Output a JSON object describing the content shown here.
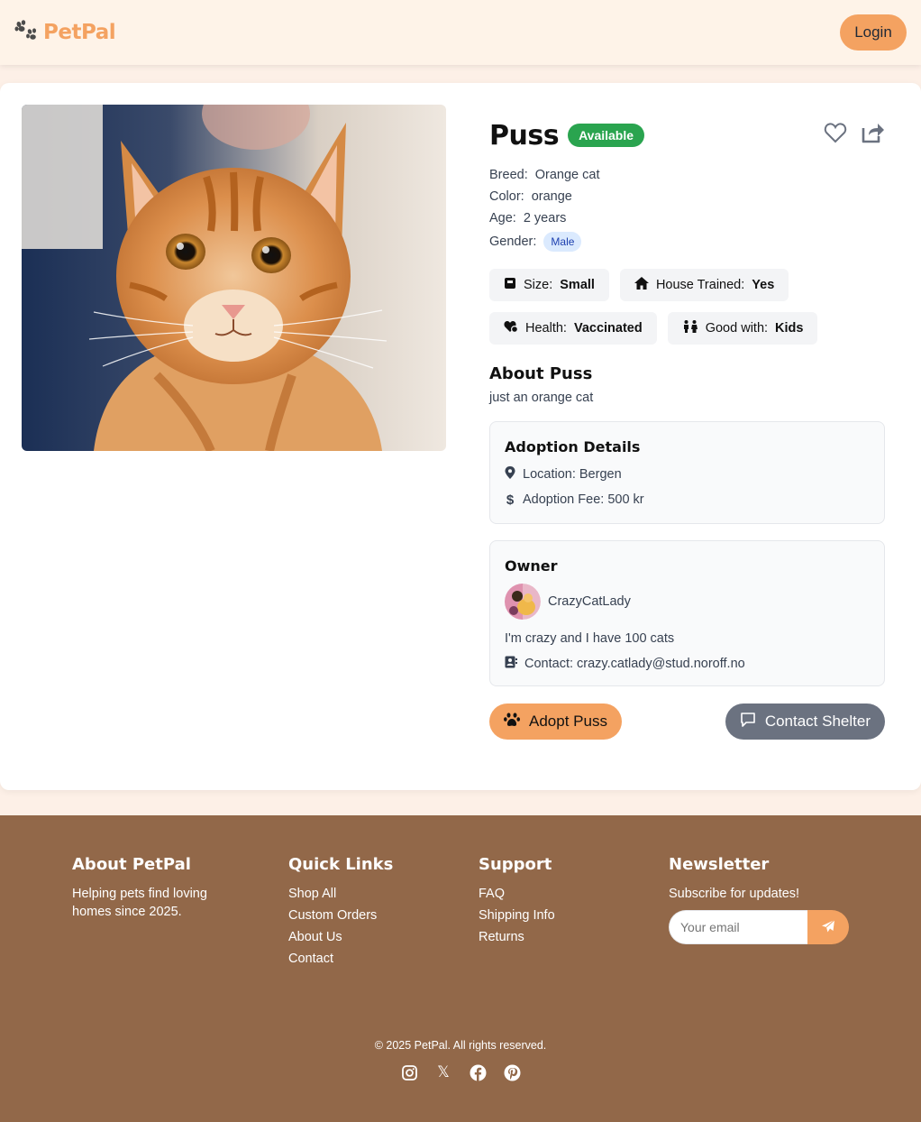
{
  "header": {
    "brand": "PetPal",
    "login_label": "Login"
  },
  "pet": {
    "name": "Puss",
    "status": "Available",
    "facts": [
      {
        "label": "Breed:",
        "value": "Orange cat"
      },
      {
        "label": "Color:",
        "value": "orange"
      },
      {
        "label": "Age:",
        "value": "2 years"
      },
      {
        "label": "Gender:",
        "value": "Male"
      }
    ],
    "chips": [
      {
        "label": "Size:",
        "value": "Small",
        "icon": "ruler-box-icon"
      },
      {
        "label": "House Trained:",
        "value": "Yes",
        "icon": "house-icon"
      },
      {
        "label": "Health:",
        "value": "Vaccinated",
        "icon": "heart-shield-icon"
      },
      {
        "label": "Good with:",
        "value": "Kids",
        "icon": "children-icon"
      }
    ],
    "about_title": "About Puss",
    "about_text": "just an orange cat"
  },
  "adoption": {
    "title": "Adoption Details",
    "location": "Location: Bergen",
    "fee": "Adoption Fee: 500 kr"
  },
  "owner": {
    "title": "Owner",
    "name": "CrazyCatLady",
    "bio": "I'm crazy and I have 100 cats",
    "contact": "Contact: crazy.catlady@stud.noroff.no"
  },
  "actions": {
    "adopt_label": "Adopt Puss",
    "contact_label": "Contact Shelter"
  },
  "footer": {
    "about": {
      "title": "About PetPal",
      "text": "Helping pets find loving homes since 2025."
    },
    "quick_links": {
      "title": "Quick Links",
      "items": [
        "Shop All",
        "Custom Orders",
        "About Us",
        "Contact"
      ]
    },
    "support": {
      "title": "Support",
      "items": [
        "FAQ",
        "Shipping Info",
        "Returns"
      ]
    },
    "newsletter": {
      "title": "Newsletter",
      "text": "Subscribe for updates!",
      "placeholder": "Your email"
    },
    "copyright": "© 2025 PetPal. All rights reserved.",
    "social_icons": [
      "instagram-icon",
      "x-icon",
      "facebook-icon",
      "pinterest-icon"
    ],
    "x_glyph": "𝕏"
  },
  "colors": {
    "accent": "#f4a261",
    "footer_bg": "#926849",
    "available": "#2aa44f",
    "header_bg": "#fef3e8",
    "contact_btn": "#6b7280"
  }
}
